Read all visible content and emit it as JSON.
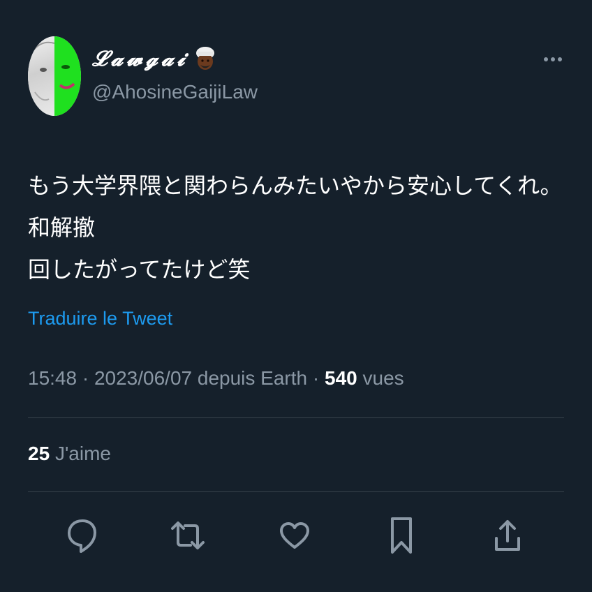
{
  "user": {
    "display_name": "𝓛𝓪𝔀𝓰𝓪𝓲",
    "handle": "@AhosineGaijiLaw",
    "name_emoji": "man-with-turban-dark-skin"
  },
  "tweet": {
    "text_line1": "もう大学界隈と関わらんみたいやから安心してくれ。和解撤",
    "text_line2": "回したがってたけど笑",
    "translate_label": "Traduire le Tweet"
  },
  "meta": {
    "time": "15:48",
    "separator": " · ",
    "date": "2023/06/07",
    "source": "depuis Earth",
    "views_count": "540",
    "views_label": "vues"
  },
  "stats": {
    "likes_count": "25",
    "likes_label": "J'aime"
  },
  "actions": {
    "icons": [
      "reply-icon",
      "retweet-icon",
      "like-icon",
      "bookmark-icon",
      "share-icon"
    ]
  },
  "colors": {
    "background": "#15202b",
    "text_primary": "#ffffff",
    "text_secondary": "#8b98a5",
    "link": "#1d9bf0",
    "divider": "#38444d"
  }
}
